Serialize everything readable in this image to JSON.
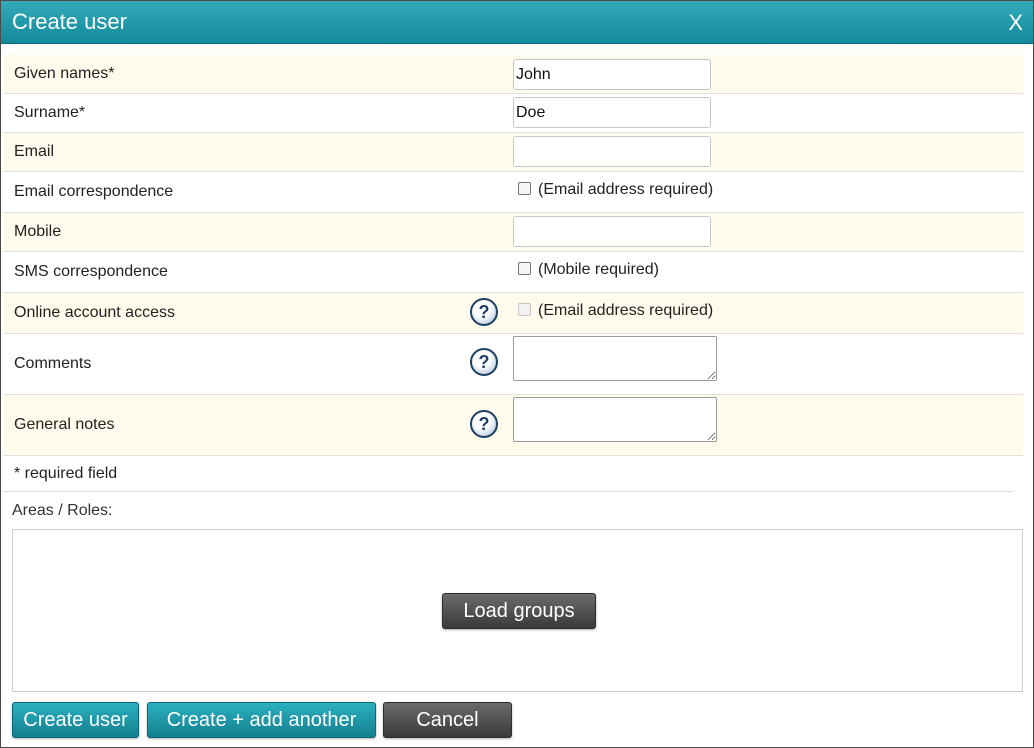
{
  "dialog": {
    "title": "Create user",
    "close_label": "X"
  },
  "fields": {
    "given_names": {
      "label": "Given names*",
      "value": "John"
    },
    "surname": {
      "label": "Surname*",
      "value": "Doe"
    },
    "email": {
      "label": "Email",
      "value": ""
    },
    "email_correspondence": {
      "label": "Email correspondence",
      "checkbox_label": "(Email address required)",
      "checked": false
    },
    "mobile": {
      "label": "Mobile",
      "value": ""
    },
    "sms_correspondence": {
      "label": "SMS correspondence",
      "checkbox_label": "(Mobile required)",
      "checked": false
    },
    "online_account_access": {
      "label": "Online account access",
      "checkbox_label": "(Email address required)",
      "checked": false,
      "disabled": true
    },
    "comments": {
      "label": "Comments",
      "value": ""
    },
    "general_notes": {
      "label": "General notes",
      "value": ""
    }
  },
  "help_icon_glyph": "?",
  "required_note": "* required field",
  "areas": {
    "label": "Areas / Roles:",
    "load_groups_label": "Load groups"
  },
  "actions": {
    "create_user": "Create user",
    "create_add_another": "Create + add another",
    "cancel": "Cancel"
  },
  "colors": {
    "title_bar": "#1a95a6",
    "row_highlight": "#fefbec",
    "primary_button": "#1e98a8",
    "dark_button": "#4a4a4a",
    "help_icon": "#1f3f66"
  },
  "icons": {
    "help": "help-question-icon",
    "close": "close-icon"
  }
}
